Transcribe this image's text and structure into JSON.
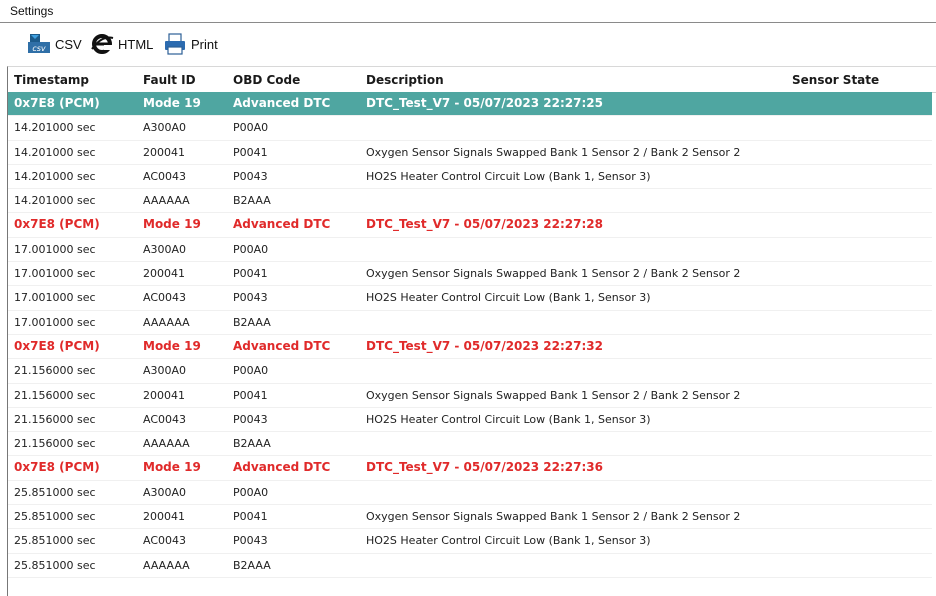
{
  "settings": {
    "label": "Settings"
  },
  "toolbar": {
    "csv_label": "CSV",
    "html_label": "HTML",
    "print_label": "Print",
    "csv_icon_text": "csv"
  },
  "colors": {
    "selected_row": "#4fa6a1",
    "group_text": "#e02a2a"
  },
  "table": {
    "headers": [
      "Timestamp",
      "Fault ID",
      "OBD Code",
      "Description",
      "Sensor State"
    ],
    "rows": [
      {
        "type": "group",
        "selected": true,
        "cells": [
          "0x7E8 (PCM)",
          "Mode 19",
          "Advanced DTC",
          "DTC_Test_V7 - 05/07/2023 22:27:25",
          ""
        ]
      },
      {
        "type": "data",
        "cells": [
          "14.201000 sec",
          "A300A0",
          "P00A0",
          "",
          ""
        ]
      },
      {
        "type": "data",
        "cells": [
          "14.201000 sec",
          "200041",
          "P0041",
          "Oxygen Sensor Signals Swapped Bank 1 Sensor 2 / Bank 2 Sensor 2",
          ""
        ]
      },
      {
        "type": "data",
        "cells": [
          "14.201000 sec",
          "AC0043",
          "P0043",
          "HO2S Heater Control Circuit Low (Bank 1, Sensor 3)",
          ""
        ]
      },
      {
        "type": "data",
        "cells": [
          "14.201000 sec",
          "AAAAAA",
          "B2AAA",
          "",
          ""
        ]
      },
      {
        "type": "group",
        "selected": false,
        "cells": [
          "0x7E8 (PCM)",
          "Mode 19",
          "Advanced DTC",
          "DTC_Test_V7 - 05/07/2023 22:27:28",
          ""
        ]
      },
      {
        "type": "data",
        "cells": [
          "17.001000 sec",
          "A300A0",
          "P00A0",
          "",
          ""
        ]
      },
      {
        "type": "data",
        "cells": [
          "17.001000 sec",
          "200041",
          "P0041",
          "Oxygen Sensor Signals Swapped Bank 1 Sensor 2 / Bank 2 Sensor 2",
          ""
        ]
      },
      {
        "type": "data",
        "cells": [
          "17.001000 sec",
          "AC0043",
          "P0043",
          "HO2S Heater Control Circuit Low (Bank 1, Sensor 3)",
          ""
        ]
      },
      {
        "type": "data",
        "cells": [
          "17.001000 sec",
          "AAAAAA",
          "B2AAA",
          "",
          ""
        ]
      },
      {
        "type": "group",
        "selected": false,
        "cells": [
          "0x7E8 (PCM)",
          "Mode 19",
          "Advanced DTC",
          "DTC_Test_V7 - 05/07/2023 22:27:32",
          ""
        ]
      },
      {
        "type": "data",
        "cells": [
          "21.156000 sec",
          "A300A0",
          "P00A0",
          "",
          ""
        ]
      },
      {
        "type": "data",
        "cells": [
          "21.156000 sec",
          "200041",
          "P0041",
          "Oxygen Sensor Signals Swapped Bank 1 Sensor 2 / Bank 2 Sensor 2",
          ""
        ]
      },
      {
        "type": "data",
        "cells": [
          "21.156000 sec",
          "AC0043",
          "P0043",
          "HO2S Heater Control Circuit Low (Bank 1, Sensor 3)",
          ""
        ]
      },
      {
        "type": "data",
        "cells": [
          "21.156000 sec",
          "AAAAAA",
          "B2AAA",
          "",
          ""
        ]
      },
      {
        "type": "group",
        "selected": false,
        "cells": [
          "0x7E8 (PCM)",
          "Mode 19",
          "Advanced DTC",
          "DTC_Test_V7 - 05/07/2023 22:27:36",
          ""
        ]
      },
      {
        "type": "data",
        "cells": [
          "25.851000 sec",
          "A300A0",
          "P00A0",
          "",
          ""
        ]
      },
      {
        "type": "data",
        "cells": [
          "25.851000 sec",
          "200041",
          "P0041",
          "Oxygen Sensor Signals Swapped Bank 1 Sensor 2 / Bank 2 Sensor 2",
          ""
        ]
      },
      {
        "type": "data",
        "cells": [
          "25.851000 sec",
          "AC0043",
          "P0043",
          "HO2S Heater Control Circuit Low (Bank 1, Sensor 3)",
          ""
        ]
      },
      {
        "type": "data",
        "cells": [
          "25.851000 sec",
          "AAAAAA",
          "B2AAA",
          "",
          ""
        ]
      }
    ]
  }
}
